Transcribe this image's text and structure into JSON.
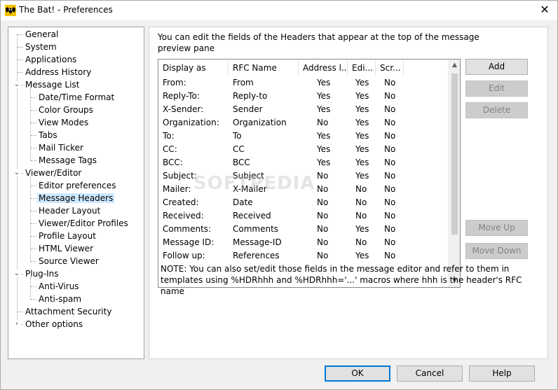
{
  "window": {
    "title": "The Bat! - Preferences",
    "close_glyph": "✕"
  },
  "tree": {
    "items": [
      {
        "label": "General",
        "level": 0
      },
      {
        "label": "System",
        "level": 0
      },
      {
        "label": "Applications",
        "level": 0
      },
      {
        "label": "Address History",
        "level": 0
      },
      {
        "label": "Message List",
        "level": 0,
        "expanded": true
      },
      {
        "label": "Date/Time Format",
        "level": 1
      },
      {
        "label": "Color Groups",
        "level": 1
      },
      {
        "label": "View Modes",
        "level": 1
      },
      {
        "label": "Tabs",
        "level": 1
      },
      {
        "label": "Mail Ticker",
        "level": 1
      },
      {
        "label": "Message Tags",
        "level": 1
      },
      {
        "label": "Viewer/Editor",
        "level": 0,
        "expanded": true
      },
      {
        "label": "Editor preferences",
        "level": 1
      },
      {
        "label": "Message Headers",
        "level": 1,
        "selected": true
      },
      {
        "label": "Header Layout",
        "level": 1
      },
      {
        "label": "Viewer/Editor Profiles",
        "level": 1
      },
      {
        "label": "Profile Layout",
        "level": 1
      },
      {
        "label": "HTML Viewer",
        "level": 1
      },
      {
        "label": "Source Viewer",
        "level": 1
      },
      {
        "label": "Plug-Ins",
        "level": 0,
        "expanded": true
      },
      {
        "label": "Anti-Virus",
        "level": 1
      },
      {
        "label": "Anti-spam",
        "level": 1
      },
      {
        "label": "Attachment Security",
        "level": 0
      },
      {
        "label": "Other options",
        "level": 0,
        "collapsed": true
      }
    ]
  },
  "panel": {
    "intro": "You can edit the fields of the Headers that appear at the top of the message preview pane",
    "columns": [
      "Display as",
      "RFC Name",
      "Address l...",
      "Edi...",
      "Scr..."
    ],
    "rows": [
      [
        "From:",
        "From",
        "Yes",
        "Yes",
        "No"
      ],
      [
        "Reply-To:",
        "Reply-to",
        "Yes",
        "Yes",
        "No"
      ],
      [
        "X-Sender:",
        "Sender",
        "Yes",
        "Yes",
        "No"
      ],
      [
        "Organization:",
        "Organization",
        "No",
        "Yes",
        "No"
      ],
      [
        "To:",
        "To",
        "Yes",
        "Yes",
        "No"
      ],
      [
        "CC:",
        "CC",
        "Yes",
        "Yes",
        "No"
      ],
      [
        "BCC:",
        "BCC",
        "Yes",
        "Yes",
        "No"
      ],
      [
        "Subject:",
        "Subject",
        "No",
        "Yes",
        "No"
      ],
      [
        "Mailer:",
        "X-Mailer",
        "No",
        "No",
        "No"
      ],
      [
        "Created:",
        "Date",
        "No",
        "No",
        "No"
      ],
      [
        "Received:",
        "Received",
        "No",
        "No",
        "No"
      ],
      [
        "Comments:",
        "Comments",
        "No",
        "Yes",
        "No"
      ],
      [
        "Message ID:",
        "Message-ID",
        "No",
        "No",
        "No"
      ],
      [
        "Follow up:",
        "References",
        "No",
        "Yes",
        "No"
      ]
    ],
    "note": "NOTE: You can also set/edit those fields in the message editor and refer to them in templates using %HDRhhh and %HDRhhh='...' macros where hhh is the header's RFC name",
    "buttons": {
      "add": "Add",
      "edit": "Edit",
      "delete": "Delete",
      "move_up": "Move Up",
      "move_down": "Move Down"
    },
    "watermark": "SOFTPEDIA"
  },
  "footer": {
    "ok": "OK",
    "cancel": "Cancel",
    "help": "Help"
  }
}
